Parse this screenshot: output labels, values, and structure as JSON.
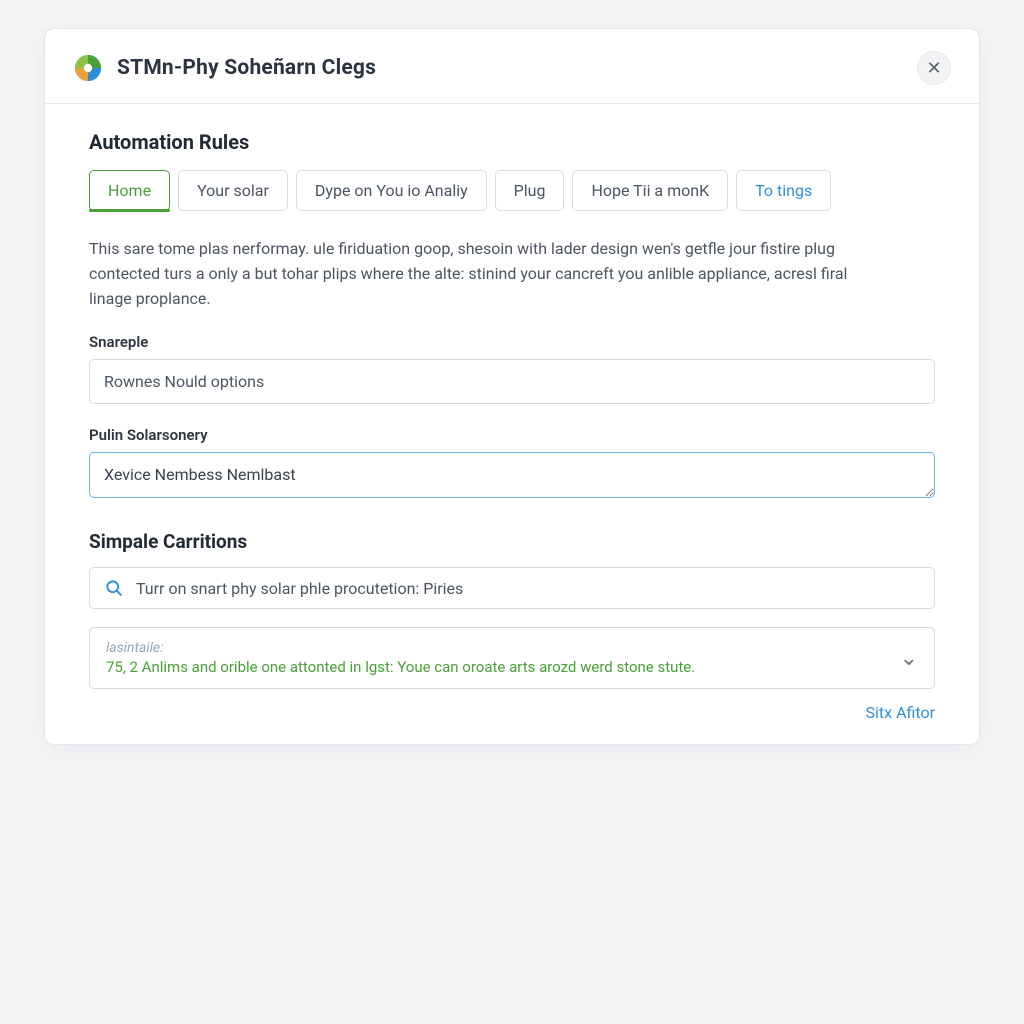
{
  "header": {
    "app_title": "STMn-Phy Soheñarn Clegs"
  },
  "main": {
    "section_title": "Automation Rules",
    "tabs": [
      {
        "label": "Home",
        "active": true
      },
      {
        "label": "Your solar"
      },
      {
        "label": "Dype on You io Analiy"
      },
      {
        "label": "Plug"
      },
      {
        "label": "Hope Tii a monK"
      },
      {
        "label": "To tings",
        "accent": true
      }
    ],
    "description": "This sare tome plas nerformay. ule firiduation goop, shesoin with lader design wen's getfle jour fistire plug contected turs a only a but tohar plips where the alte: stinind your cancreft you anlible appliance, acresl firal linage proplance.",
    "field1": {
      "label": "Snareple",
      "value": "Rownes Nould options"
    },
    "field2": {
      "label": "Pulin Solarsonery",
      "value": "Xevice Nembess Nemlbast"
    },
    "subsection_title": "Simpale Carritions",
    "search": {
      "value": "Turr on snart phy solar phle procutetion: Piries"
    },
    "status": {
      "label": "lasintaile:",
      "message": "75, 2 Anlims and orible one attonted in lgst: Youe can oroate arts arozd werd stone stute."
    },
    "footer_action": "Sitx Afitor"
  }
}
